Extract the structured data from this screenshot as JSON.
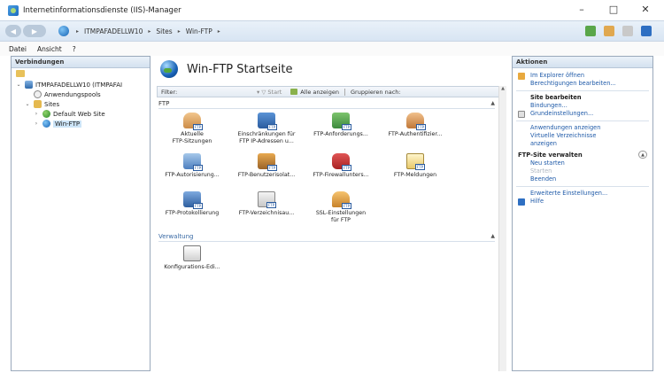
{
  "window": {
    "title": "Internetinformationsdienste (IIS)-Manager",
    "controls": [
      "–",
      "□",
      "✕"
    ]
  },
  "address": {
    "crumbs": [
      "ITMPAFADELLW10",
      "Sites",
      "Win-FTP"
    ],
    "sep": "▸"
  },
  "menu": {
    "file": "Datei",
    "view": "Ansicht",
    "help": "?"
  },
  "left_pane": {
    "header": "Verbindungen",
    "tree": {
      "server": "ITMPAFADELLW10 (ITMPAFAI",
      "app_pools": "Anwendungspools",
      "sites": "Sites",
      "default_site": "Default Web Site",
      "ftp_site": "Win-FTP"
    }
  },
  "center": {
    "title": "Win-FTP Startseite",
    "filter": {
      "label": "Filter:",
      "start": "Start",
      "show_all": "Alle anzeigen",
      "group_by": "Gruppieren nach:"
    },
    "groups": {
      "ftp": "FTP",
      "admin": "Verwaltung"
    },
    "features": {
      "sessions": [
        "Aktuelle",
        "FTP-Sitzungen"
      ],
      "ip_restrictions": [
        "Einschränkungen für",
        "FTP IP-Adressen u..."
      ],
      "request_filtering": [
        "FTP-Anforderungs..."
      ],
      "authentication": [
        "FTP-Authentifizier..."
      ],
      "authorization": [
        "FTP-Autorisierung..."
      ],
      "user_isolation": [
        "FTP-Benutzerisolat..."
      ],
      "firewall": [
        "FTP-Firewallunters..."
      ],
      "messages": [
        "FTP-Meldungen"
      ],
      "logging": [
        "FTP-Protokollierung"
      ],
      "directory_browsing": [
        "FTP-Verzeichnisau..."
      ],
      "ssl": [
        "SSL-Einstellungen",
        "für FTP"
      ],
      "config_editor": [
        "Konfigurations-Edi..."
      ]
    },
    "badge": "FTP"
  },
  "actions": {
    "header": "Aktionen",
    "explore": "Im Explorer öffnen",
    "edit_permissions": "Berechtigungen bearbeiten...",
    "edit_site_head": "Site bearbeiten",
    "bindings": "Bindungen...",
    "basic_settings": "Grundeinstellungen...",
    "view_apps": "Anwendungen anzeigen",
    "view_vdirs_1": "Virtuelle Verzeichnisse",
    "view_vdirs_2": "anzeigen",
    "manage_head": "FTP-Site verwalten",
    "restart": "Neu starten",
    "start": "Starten",
    "stop": "Beenden",
    "advanced": "Erweiterte Einstellungen...",
    "help": "Hilfe"
  },
  "colors": {
    "accent": "#1f5aa8",
    "disabled": "#aeb6c0",
    "header_bg": "#d8e5f3"
  }
}
